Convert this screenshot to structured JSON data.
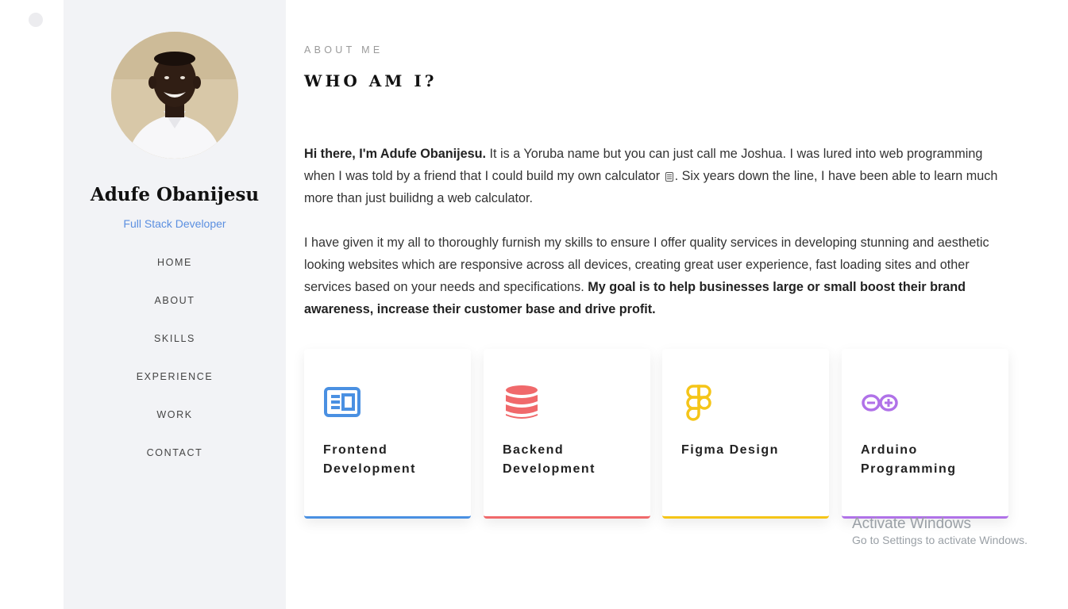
{
  "profile": {
    "name": "Adufe Obanijesu",
    "role": "Full Stack Developer"
  },
  "nav": {
    "items": [
      "HOME",
      "ABOUT",
      "SKILLS",
      "EXPERIENCE",
      "WORK",
      "CONTACT"
    ]
  },
  "about": {
    "kicker": "ABOUT ME",
    "title": "WHO AM I?",
    "p1_bold": "Hi there, I'm Adufe Obanijesu.",
    "p1_text_a": " It is a Yoruba name but you can just call me Joshua. I was lured into web programming when I was told by a friend that I could build my own calculator ",
    "p1_text_b": ". Six years down the line, I have been able to learn much more than just builidng a web calculator.",
    "p2_text": "I have given it my all to thoroughly furnish my skills to ensure I offer quality services in developing stunning and aesthetic looking websites which are responsive across all devices, creating great user experience, fast loading sites and other services based on your needs and specifications. ",
    "p2_bold": "My goal is to help businesses large or small boost their brand awareness, increase their customer base and drive profit."
  },
  "services": [
    {
      "title": "Frontend Development",
      "icon": "newspaper-icon",
      "color": "#4a90e2"
    },
    {
      "title": "Backend Development",
      "icon": "database-icon",
      "color": "#f0696b"
    },
    {
      "title": "Figma Design",
      "icon": "figma-icon",
      "color": "#f5c518"
    },
    {
      "title": "Arduino Programming",
      "icon": "arduino-icon",
      "color": "#b072e8"
    }
  ],
  "watermark": {
    "title": "Activate Windows",
    "subtitle": "Go to Settings to activate Windows."
  }
}
